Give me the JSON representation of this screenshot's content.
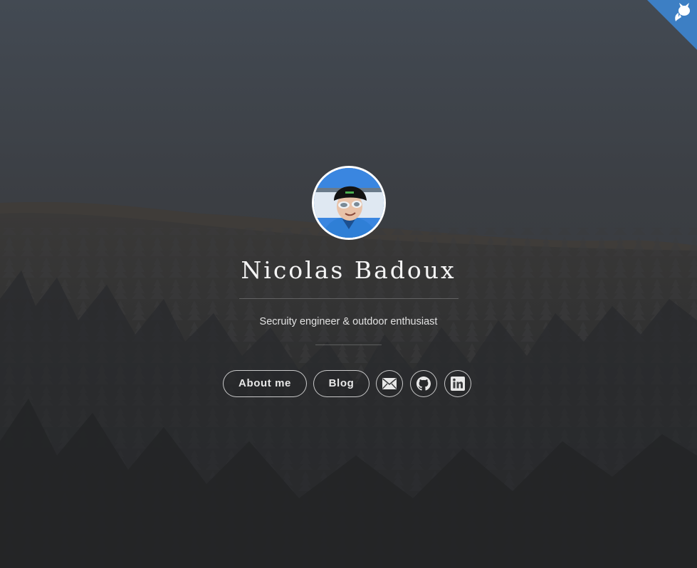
{
  "profile": {
    "name": "Nicolas Badoux",
    "tagline": "Secruity engineer & outdoor enthusiast"
  },
  "nav": {
    "about_label": "About me",
    "blog_label": "Blog"
  },
  "social": {
    "email_icon": "envelope-icon",
    "github_icon": "github-icon",
    "linkedin_icon": "linkedin-icon"
  },
  "corner_ribbon": {
    "icon": "octocat-icon",
    "color": "#3d7fc4"
  },
  "colors": {
    "sky_top": "#434a54",
    "forest_dark": "#26282a",
    "text": "#f4f4f4"
  }
}
